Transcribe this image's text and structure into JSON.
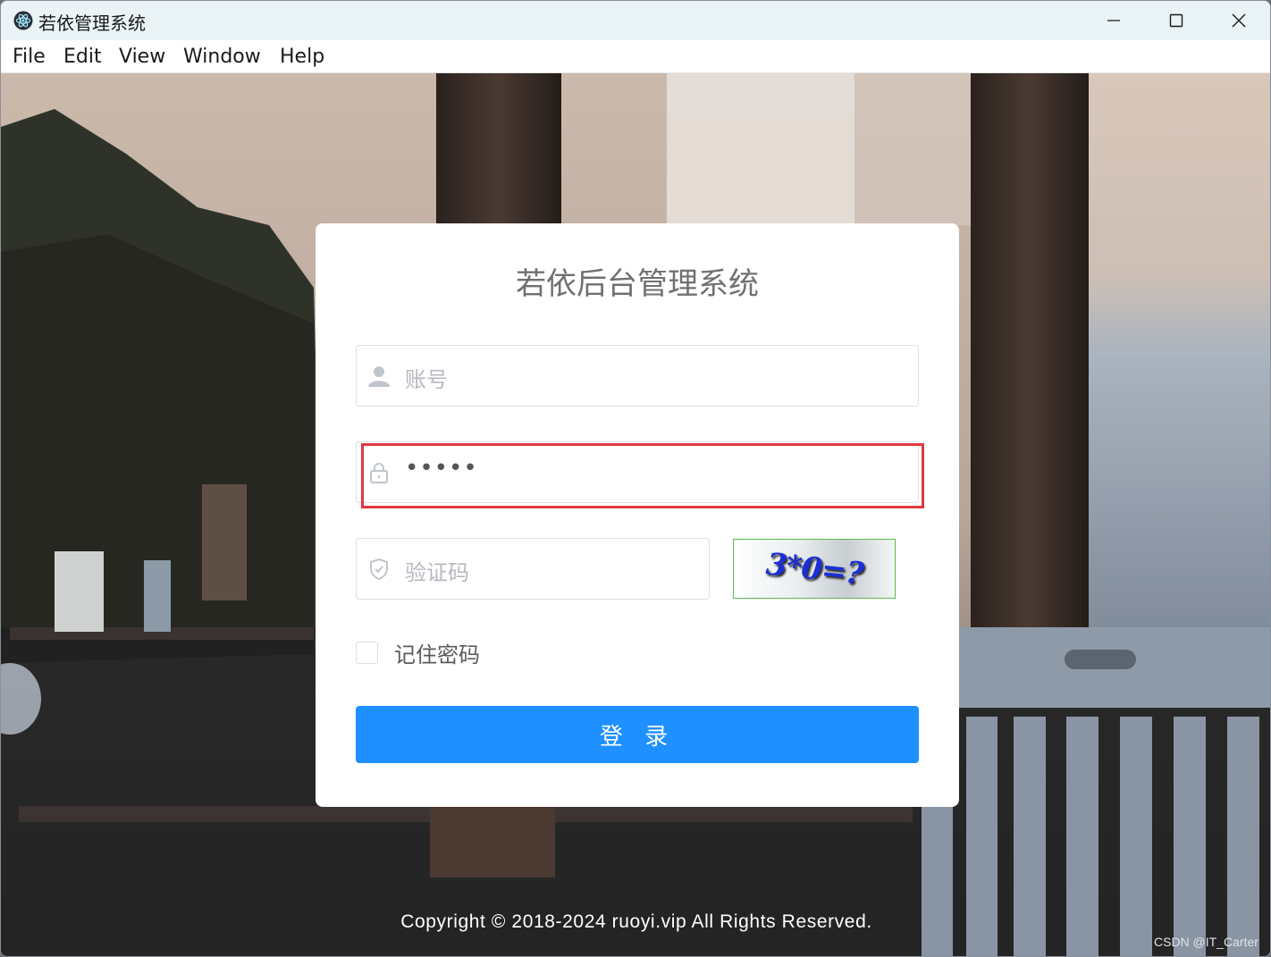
{
  "window": {
    "title": "若依管理系统",
    "icon": "electron-app-icon"
  },
  "menu": {
    "items": [
      "File",
      "Edit",
      "View",
      "Window",
      "Help"
    ]
  },
  "login": {
    "title": "若依后台管理系统",
    "username_placeholder": "账号",
    "password_value": "•••••",
    "captcha_placeholder": "验证码",
    "captcha_text": "3*0=?",
    "remember_label": "记住密码",
    "remember_checked": false,
    "login_button": "登 录"
  },
  "footer": {
    "copyright": "Copyright © 2018-2024 ruoyi.vip All Rights Reserved.",
    "watermark": "CSDN @IT_Carter"
  },
  "colors": {
    "primary": "#1e90ff",
    "highlight_border": "#e0393e",
    "captcha_border": "#58b84b"
  }
}
